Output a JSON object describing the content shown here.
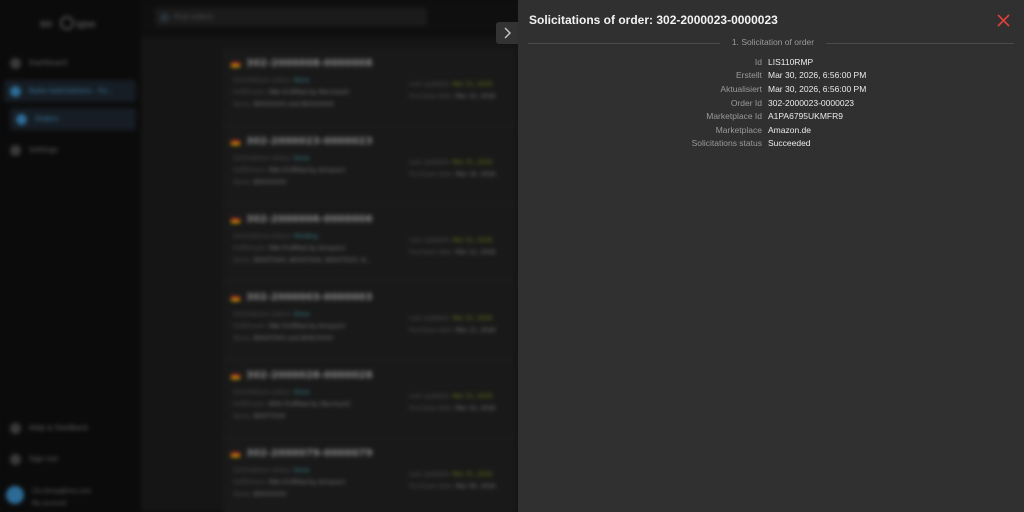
{
  "app": {
    "sidebar": {
      "items": [
        {
          "label": "Dashboard"
        },
        {
          "label": "Ratio Solicitations - Fo..."
        },
        {
          "label": "Orders"
        },
        {
          "label": "Settings"
        }
      ],
      "bottom": [
        {
          "label": "Help & Feedback"
        },
        {
          "label": "Sign out"
        }
      ],
      "user": {
        "email": "Chr.Hirse@hiro.com",
        "account": "My account"
      }
    },
    "search": {
      "placeholder": "Find orders"
    },
    "orders": [
      {
        "id": "302-2000008-0000008",
        "status_label": "Solicitations status:",
        "status": "None",
        "fulfil_label": "Fulfillment:",
        "fulfil": "FBA (Fulfilled by Merchant)",
        "items_label": "Items:",
        "items": "B0XXXXXX and B0XXXXXX",
        "updated_label": "Last updated:",
        "updated": "Mar 31, 2026",
        "ordered_label": "Purchase date:",
        "ordered": "Mar 15, 2026"
      },
      {
        "id": "302-2000023-0000023",
        "status_label": "Solicitations status:",
        "status": "Done",
        "fulfil_label": "Fulfillment:",
        "fulfil": "FBA (Fulfilled by Amazon)",
        "items_label": "Items:",
        "items": "B0XXXXXX",
        "updated_label": "Last updated:",
        "updated": "Mar 31, 2026",
        "ordered_label": "Purchase date:",
        "ordered": "Mar 16, 2026"
      },
      {
        "id": "302-2000006-0000006",
        "status_label": "Solicitations status:",
        "status": "Pending",
        "fulfil_label": "Fulfillment:",
        "fulfil": "FBA (Fulfilled by Amazon)",
        "items_label": "Items:",
        "items": "B0XXTXXX, B0XXTXXX, B0XXTXXX, B...",
        "updated_label": "Last updated:",
        "updated": "Mar 31, 2026",
        "ordered_label": "Purchase date:",
        "ordered": "Mar 12, 2026"
      },
      {
        "id": "302-2000003-0000003",
        "status_label": "Solicitations status:",
        "status": "Done",
        "fulfil_label": "Fulfillment:",
        "fulfil": "FBA (Fulfilled by Amazon)",
        "items_label": "Items:",
        "items": "B0XXTXXX and B0XCXXXX",
        "updated_label": "Last updated:",
        "updated": "Mar 31, 2026",
        "ordered_label": "Purchase date:",
        "ordered": "Mar 11, 2026"
      },
      {
        "id": "302-2000028-0000028",
        "status_label": "Solicitations status:",
        "status": "Done",
        "fulfil_label": "Fulfillment:",
        "fulfil": "MFN (Fulfilled by Merchant)",
        "items_label": "Items:",
        "items": "B0XTTXXX",
        "updated_label": "Last updated:",
        "updated": "Mar 31, 2026",
        "ordered_label": "Purchase date:",
        "ordered": "Mar 10, 2026"
      },
      {
        "id": "302-2000079-0000079",
        "status_label": "Solicitations status:",
        "status": "Done",
        "fulfil_label": "Fulfillment:",
        "fulfil": "FBA (Fulfilled by Amazon)",
        "items_label": "Items:",
        "items": "B0XXXXXX",
        "updated_label": "Last updated:",
        "updated": "Mar 31, 2026",
        "ordered_label": "Purchase date:",
        "ordered": "Mar 09, 2026"
      }
    ]
  },
  "drawer": {
    "title": "Solicitations of order: 302-2000023-0000023",
    "section": "1. Solicitation of order",
    "fields": [
      {
        "key": "Id",
        "value": "LIS110RMP"
      },
      {
        "key": "Erstellt",
        "value": "Mar 30, 2026, 6:56:00 PM"
      },
      {
        "key": "Aktualisiert",
        "value": "Mar 30, 2026, 6:56:00 PM"
      },
      {
        "key": "Order Id",
        "value": "302-2000023-0000023"
      },
      {
        "key": "Marketplace Id",
        "value": "A1PA6795UKMFR9"
      },
      {
        "key": "Marketplace",
        "value": "Amazon.de"
      },
      {
        "key": "Solicitations status",
        "value": "Succeeded"
      }
    ],
    "close_icon": "close-icon",
    "collapse_icon": "chevron-right-icon"
  },
  "colors": {
    "accent": "#2c6b95",
    "close": "#e0403a",
    "drawer_bg": "#303030"
  }
}
